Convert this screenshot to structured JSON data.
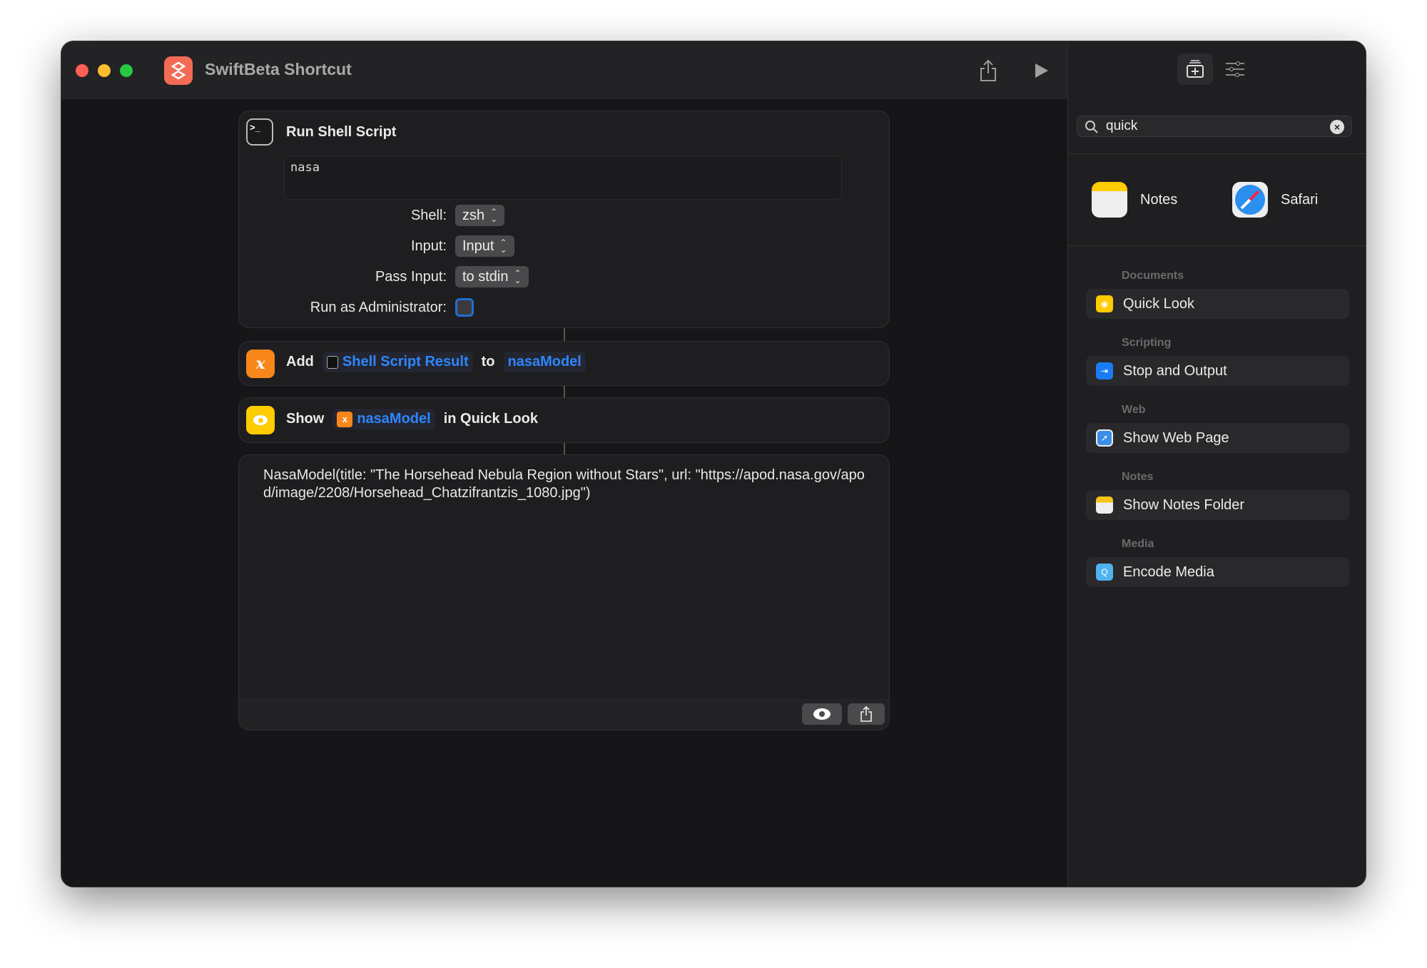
{
  "window": {
    "title": "SwiftBeta Shortcut",
    "traffic_lights": [
      "#fe5f57",
      "#febc2e",
      "#28c840"
    ],
    "app_icon_color": "#f26b55"
  },
  "toolbar": {
    "share_icon": "share-icon",
    "run_icon": "play-icon"
  },
  "actions": {
    "run_shell": {
      "title": "Run Shell Script",
      "script": "nasa",
      "shell_label": "Shell:",
      "shell_value": "zsh",
      "input_label": "Input:",
      "input_value": "Input",
      "pass_input_label": "Pass Input:",
      "pass_input_value": "to stdin",
      "admin_label": "Run as Administrator:",
      "admin_checked": false
    },
    "add": {
      "verb": "Add",
      "token1": "Shell Script Result",
      "connector": "to",
      "token2": "nasaModel"
    },
    "show": {
      "verb": "Show",
      "token": "nasaModel",
      "suffix": "in Quick Look"
    },
    "output": {
      "text": "NasaModel(title: \"The Horsehead Nebula Region without Stars\", url: \"https://apod.nasa.gov/apod/image/2208/Horsehead_Chatzifrantzis_1080.jpg\")"
    }
  },
  "sidebar": {
    "search": {
      "value": "quick"
    },
    "apps": [
      {
        "label": "Notes"
      },
      {
        "label": "Safari"
      }
    ],
    "sections": [
      {
        "header": "Documents",
        "item": "Quick Look",
        "color": "#ffcc00"
      },
      {
        "header": "Scripting",
        "item": "Stop and Output",
        "color": "#1a7cf5"
      },
      {
        "header": "Web",
        "item": "Show Web Page",
        "color": "#3b8ee8"
      },
      {
        "header": "Notes",
        "item": "Show Notes Folder",
        "color": "#f5c518"
      },
      {
        "header": "Media",
        "item": "Encode Media",
        "color": "#4fb3f0"
      }
    ]
  }
}
